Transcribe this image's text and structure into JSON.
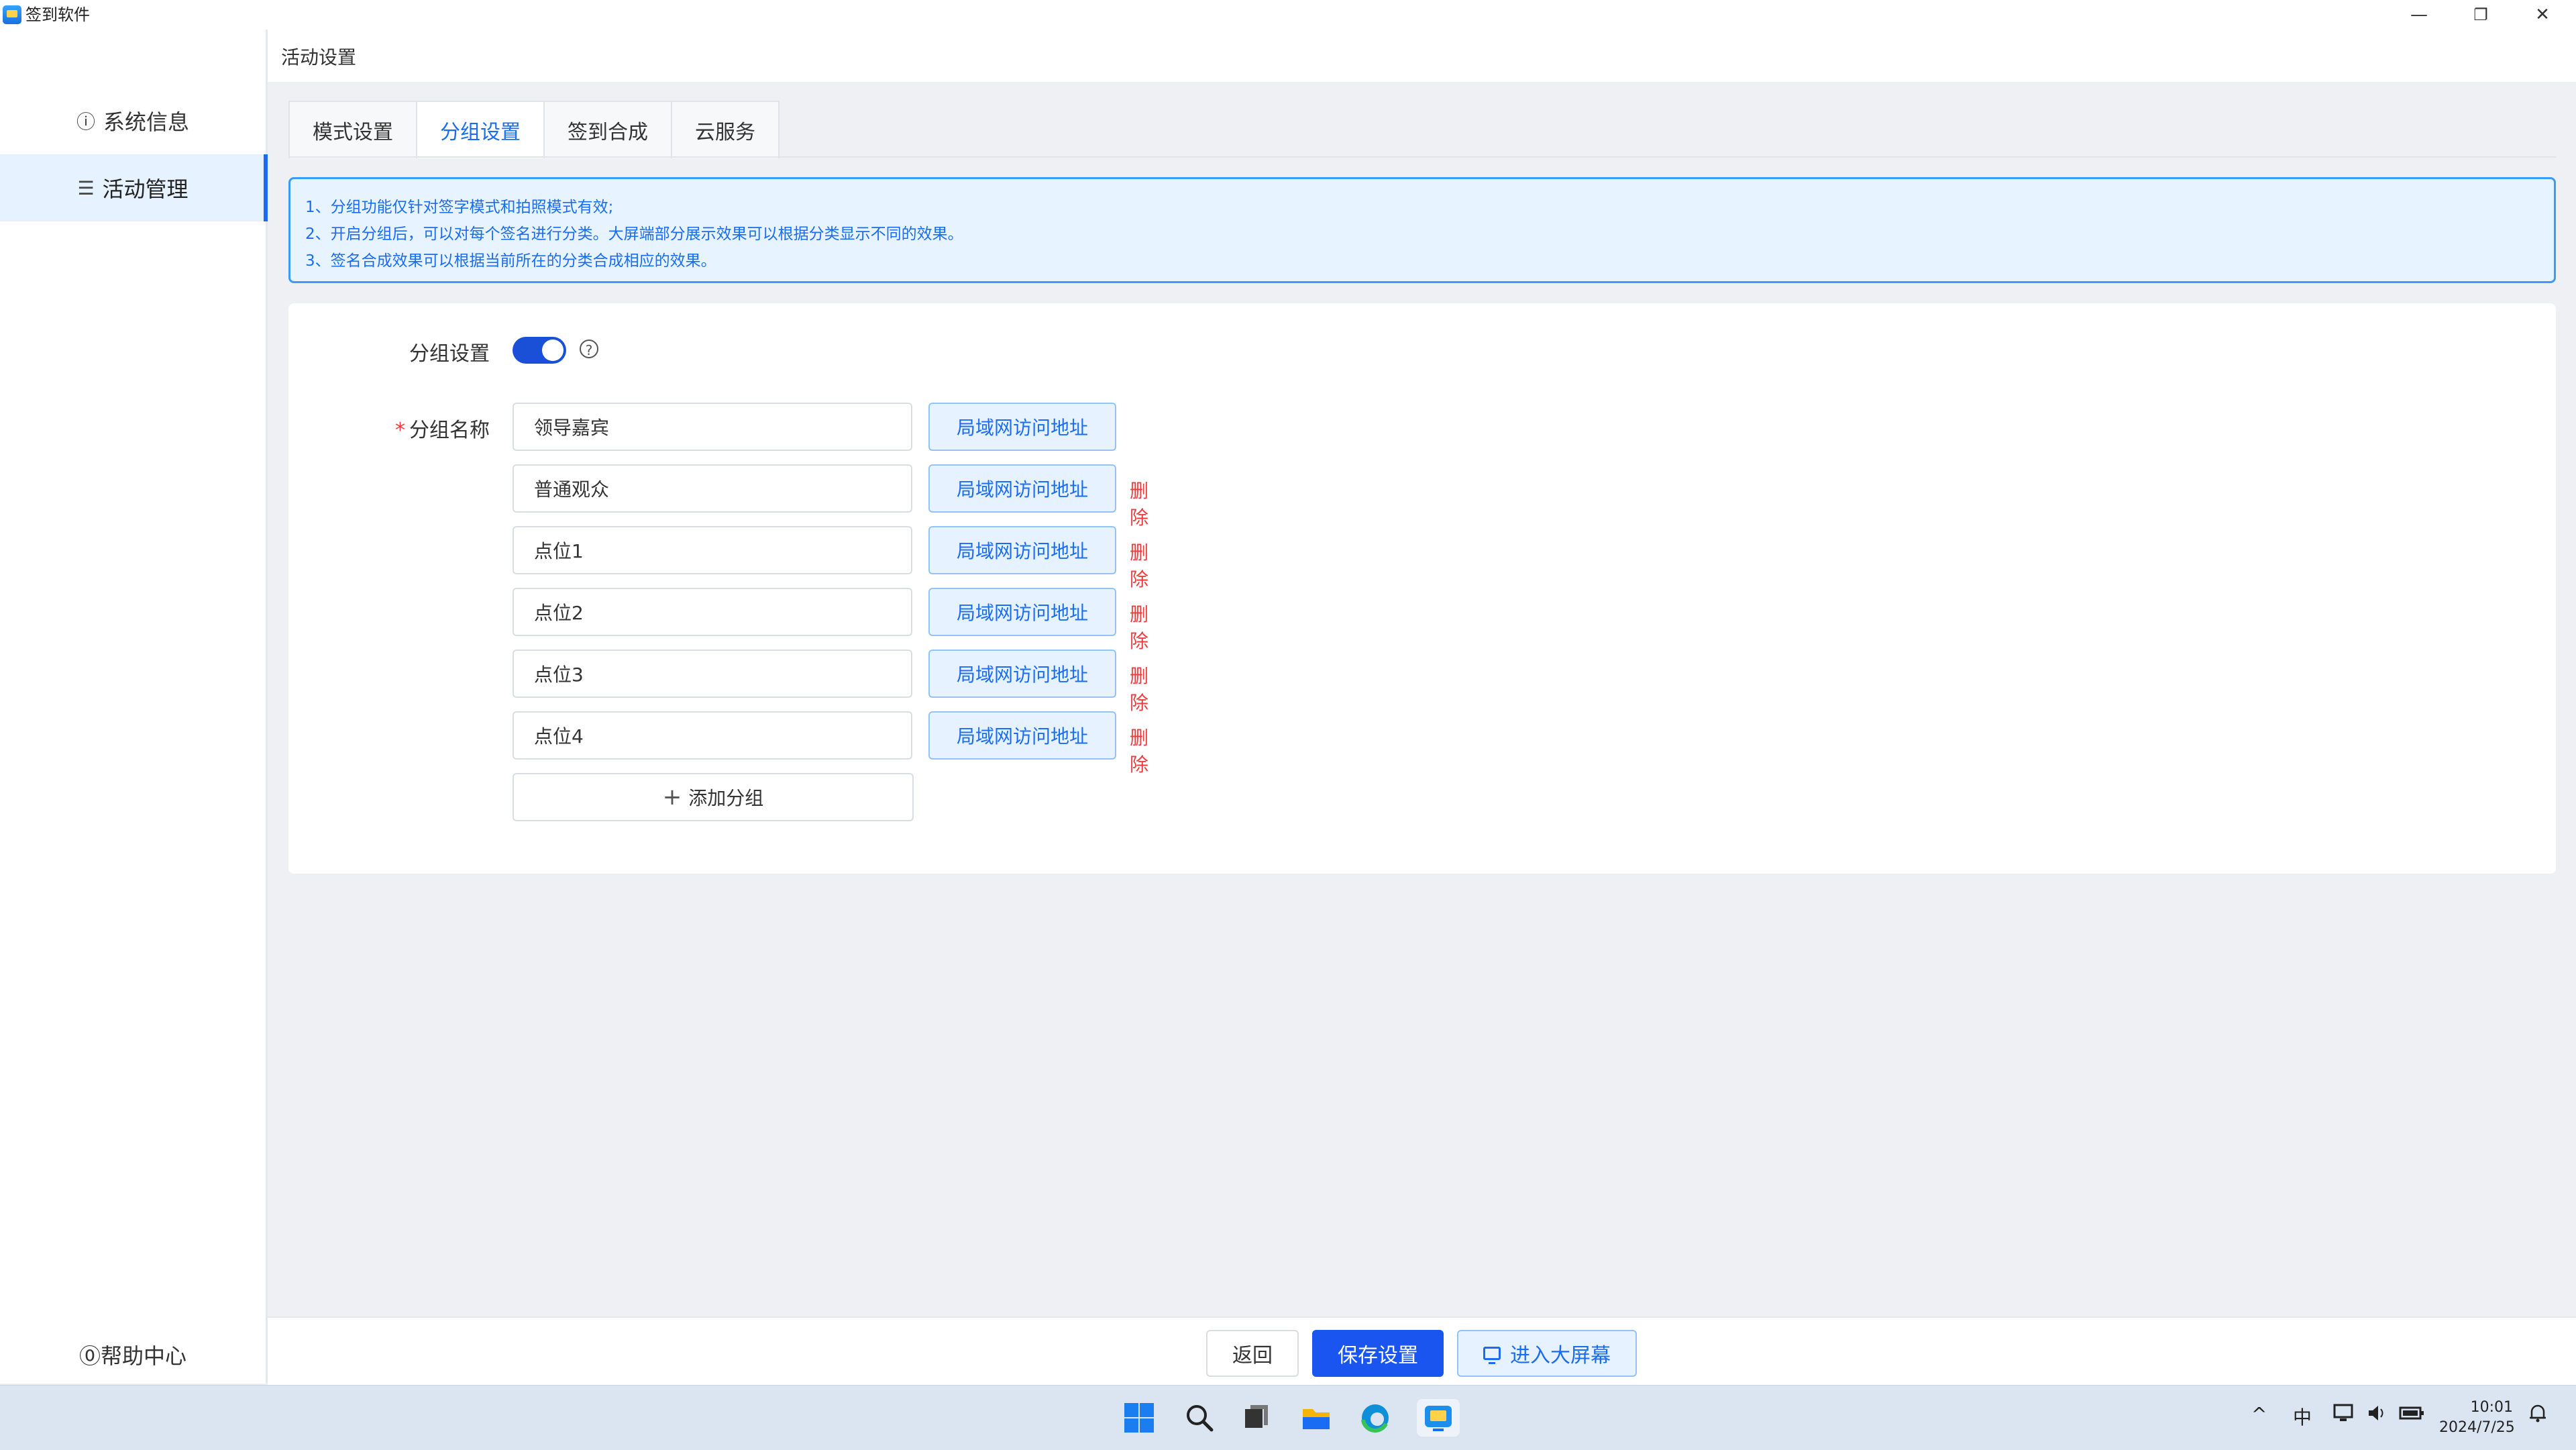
{
  "window": {
    "title": "签到软件",
    "minimize": "—",
    "restore": "❐",
    "close": "✕"
  },
  "sidebar": {
    "items": [
      {
        "label": "系统信息",
        "icon": "info-icon"
      },
      {
        "label": "活动管理",
        "icon": "list-icon"
      }
    ],
    "help_label": "⓪帮助中心"
  },
  "header": {
    "title": "活动设置"
  },
  "tabs": [
    {
      "label": "模式设置"
    },
    {
      "label": "分组设置"
    },
    {
      "label": "签到合成"
    },
    {
      "label": "云服务"
    }
  ],
  "notice": {
    "lines": [
      "1、分组功能仅针对签字模式和拍照模式有效;",
      "2、开启分组后，可以对每个签名进行分类。大屏端部分展示效果可以根据分类显示不同的效果。",
      "3、签名合成效果可以根据当前所在的分类合成相应的效果。"
    ]
  },
  "group_settings": {
    "toggle_label": "分组设置",
    "toggle_on": true,
    "name_label": "分组名称",
    "required_mark": "*",
    "lan_button_label": "局域网访问地址",
    "delete_label": "删除",
    "groups": [
      "领导嘉宾",
      "普通观众",
      "点位1",
      "点位2",
      "点位3",
      "点位4"
    ],
    "add_label": "添加分组"
  },
  "footer": {
    "back_label": "返回",
    "save_label": "保存设置",
    "screen_label": "进入大屏幕"
  },
  "taskbar": {
    "ime": "中",
    "time": "10:01",
    "date": "2024/7/25",
    "tray_chevron": "^"
  },
  "colors": {
    "primary": "#1a6df2",
    "danger": "#f03b3b",
    "save": "#1a55f0",
    "notice_bg": "#e7f4ff"
  }
}
